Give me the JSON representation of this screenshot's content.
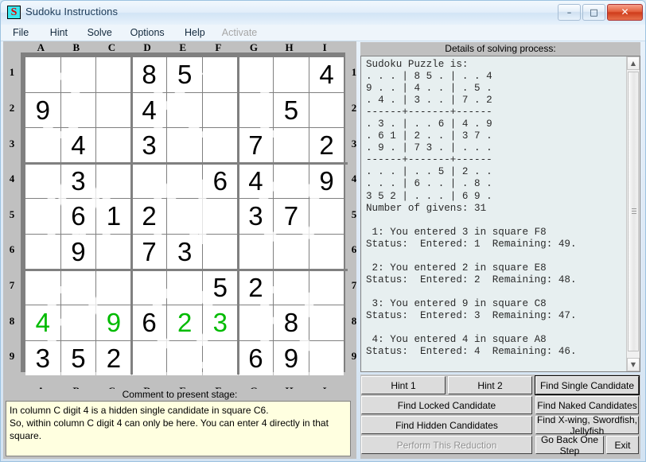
{
  "window": {
    "title": "Sudoku Instructions",
    "icon": "S",
    "minimize_label": "–",
    "maximize_label": "□",
    "close_label": "✕"
  },
  "menu": {
    "items": [
      {
        "label": "File",
        "disabled": false
      },
      {
        "label": "Hint",
        "disabled": false
      },
      {
        "label": "Solve",
        "disabled": false
      },
      {
        "label": "Options",
        "disabled": false
      },
      {
        "label": "Help",
        "disabled": false
      },
      {
        "label": "Activate",
        "disabled": true
      }
    ]
  },
  "board": {
    "column_headers": [
      "A",
      "B",
      "C",
      "D",
      "E",
      "F",
      "G",
      "H",
      "I"
    ],
    "row_headers": [
      "1",
      "2",
      "3",
      "4",
      "5",
      "6",
      "7",
      "8",
      "9"
    ],
    "watermarks": [
      "J",
      "K",
      "L",
      "M",
      "N",
      "O",
      "P",
      "Q",
      "R"
    ],
    "given_color": "#000000",
    "entered_color": "#00bb00",
    "cells": [
      [
        "",
        "",
        "",
        "8",
        "5",
        "",
        "",
        "",
        "4"
      ],
      [
        "9",
        "",
        "",
        "4",
        "",
        "",
        "",
        "5",
        ""
      ],
      [
        "",
        "4",
        "",
        "3",
        "",
        "",
        "7",
        "",
        "2"
      ],
      [
        "",
        "3",
        "",
        "",
        "",
        "6",
        "4",
        "",
        "9"
      ],
      [
        "",
        "6",
        "1",
        "2",
        "",
        "",
        "3",
        "7",
        ""
      ],
      [
        "",
        "9",
        "",
        "7",
        "3",
        "",
        "",
        "",
        ""
      ],
      [
        "",
        "",
        "",
        "",
        "",
        "5",
        "2",
        "",
        ""
      ],
      [
        "4",
        "",
        "9",
        "6",
        "2",
        "3",
        "",
        "8",
        ""
      ],
      [
        "3",
        "5",
        "2",
        "",
        "",
        "",
        "6",
        "9",
        ""
      ]
    ],
    "entered": [
      [
        false,
        false,
        false,
        false,
        false,
        false,
        false,
        false,
        false
      ],
      [
        false,
        false,
        false,
        false,
        false,
        false,
        false,
        false,
        false
      ],
      [
        false,
        false,
        false,
        false,
        false,
        false,
        false,
        false,
        false
      ],
      [
        false,
        false,
        false,
        false,
        false,
        false,
        false,
        false,
        false
      ],
      [
        false,
        false,
        false,
        false,
        false,
        false,
        false,
        false,
        false
      ],
      [
        false,
        false,
        false,
        false,
        false,
        false,
        false,
        false,
        false
      ],
      [
        false,
        false,
        false,
        false,
        false,
        false,
        false,
        false,
        false
      ],
      [
        true,
        false,
        true,
        false,
        true,
        true,
        false,
        false,
        false
      ],
      [
        false,
        false,
        false,
        false,
        false,
        false,
        false,
        false,
        false
      ]
    ]
  },
  "comment": {
    "label": "Comment to present stage:",
    "line1": "In column C digit 4 is a hidden single candidate in square C6.",
    "line2": "So, within column C digit 4 can only be here. You can enter 4 directly in that square."
  },
  "details": {
    "label": "Details of solving process:",
    "text": "Sudoku Puzzle is:\n. . . | 8 5 . | . . 4\n9 . . | 4 . . | . 5 .\n. 4 . | 3 . . | 7 . 2\n------+-------+------\n. 3 . | . . 6 | 4 . 9\n. 6 1 | 2 . . | 3 7 .\n. 9 . | 7 3 . | . . .\n------+-------+------\n. . . | . . 5 | 2 . .\n. . . | 6 . . | . 8 .\n3 5 2 | . . . | 6 9 .\nNumber of givens: 31\n\n 1: You entered 3 in square F8\nStatus:  Entered: 1  Remaining: 49.\n\n 2: You entered 2 in square E8\nStatus:  Entered: 2  Remaining: 48.\n\n 3: You entered 9 in square C8\nStatus:  Entered: 3  Remaining: 47.\n\n 4: You entered 4 in square A8\nStatus:  Entered: 4  Remaining: 46.",
    "scroll_up_label": "▲",
    "scroll_down_label": "▼"
  },
  "buttons": {
    "hint1": "Hint 1",
    "hint2": "Hint 2",
    "find_single_candidate": "Find Single Candidate",
    "find_locked_candidate": "Find Locked Candidate",
    "find_naked_candidates": "Find Naked Candidates",
    "find_hidden_candidates": "Find Hidden Candidates",
    "find_xwing": "Find X-wing, Swordfish, Jellyfish",
    "perform_this_reduction": "Perform This Reduction",
    "go_back_one_step": "Go Back One Step",
    "exit": "Exit"
  }
}
